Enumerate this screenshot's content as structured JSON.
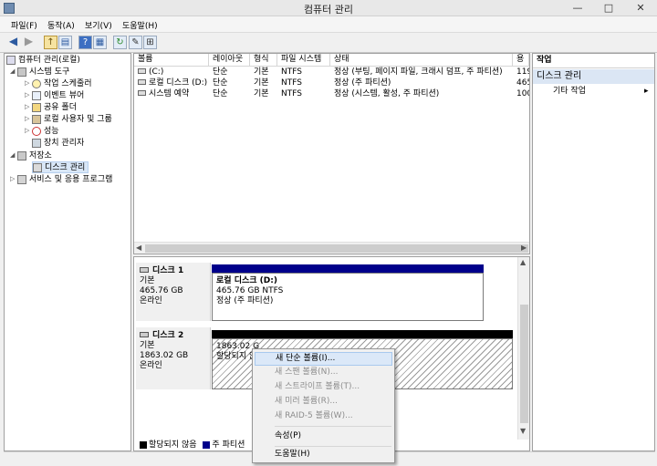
{
  "window": {
    "title": "컴퓨터 관리",
    "min": "—",
    "max": "□",
    "close": "✕"
  },
  "menu": [
    "파일(F)",
    "동작(A)",
    "보기(V)",
    "도움말(H)"
  ],
  "toolbar_icons": [
    "back-arrow-icon",
    "forward-arrow-icon",
    "folder-up-icon",
    "console-tree-icon",
    "help-icon",
    "view-icon",
    "refresh-icon",
    "properties-icon",
    "export-icon"
  ],
  "tree": {
    "root": "컴퓨터 관리(로컬)",
    "system_tools": "시스템 도구",
    "task_scheduler": "작업 스케줄러",
    "event_viewer": "이벤트 뷰어",
    "shared_folders": "공유 폴더",
    "local_users": "로컬 사용자 및 그룹",
    "performance": "성능",
    "device_manager": "장치 관리자",
    "storage": "저장소",
    "disk_management": "디스크 관리",
    "services": "서비스 및 응용 프로그램"
  },
  "volume_list": {
    "columns": [
      "볼륨",
      "레이아웃",
      "형식",
      "파일 시스템",
      "상태",
      "용"
    ],
    "rows": [
      [
        "(C:)",
        "단순",
        "기본",
        "NTFS",
        "정상 (부팅, 페이지 파일, 크래시 덤프, 주 파티션)",
        "119"
      ],
      [
        "로컬 디스크 (D:)",
        "단순",
        "기본",
        "NTFS",
        "정상 (주 파티션)",
        "465"
      ],
      [
        "시스템 예약",
        "단순",
        "기본",
        "NTFS",
        "정상 (시스템, 활성, 주 파티션)",
        "100"
      ]
    ]
  },
  "disks": [
    {
      "name": "디스크 1",
      "type": "기본",
      "size": "465.76 GB",
      "state": "온라인",
      "volume": {
        "name": "로컬 디스크 (D:)",
        "size": "465.76 GB NTFS",
        "status": "정상 (주 파티션)"
      }
    },
    {
      "name": "디스크 2",
      "type": "기본",
      "size": "1863.02 GB",
      "state": "온라인",
      "volume": {
        "size": "1863.02 G",
        "status": "할당되지 않음"
      }
    }
  ],
  "legend": {
    "unallocated": "할당되지 않음",
    "primary": "주 파티션"
  },
  "actions": {
    "header": "작업",
    "disk_management": "디스크 관리",
    "more": "기타 작업",
    "arrow": "▸"
  },
  "context_menu": {
    "new_simple": "새 단순 볼륨(I)...",
    "new_spanned": "새 스팬 볼륨(N)...",
    "new_striped": "새 스트라이프 볼륨(T)...",
    "new_mirrored": "새 미러 볼륨(R)...",
    "new_raid5": "새 RAID-5 볼륨(W)...",
    "properties": "속성(P)",
    "help": "도움말(H)"
  },
  "colors": {
    "primary_partition": "#00008b",
    "unallocated": "#000000",
    "selection": "#d9e7f7"
  }
}
